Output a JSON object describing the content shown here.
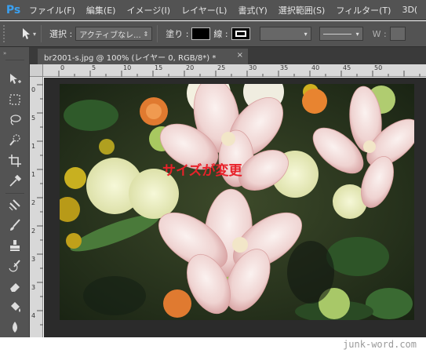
{
  "app": {
    "logo": "Ps"
  },
  "menu": {
    "items": [
      "ファイル(F)",
      "編集(E)",
      "イメージ(I)",
      "レイヤー(L)",
      "書式(Y)",
      "選択範囲(S)",
      "フィルター(T)",
      "3D("
    ]
  },
  "options": {
    "select_label": "選択 :",
    "select_value": "アクティブなレ...",
    "fill_label": "塗り :",
    "stroke_label": "線 :",
    "width_label": "W :"
  },
  "document": {
    "tab_title": "br2001-s.jpg @ 100% (レイヤー 0, RGB/8*) *",
    "close_glyph": "×"
  },
  "ruler": {
    "top_labels": [
      "0",
      "5",
      "10",
      "15",
      "20",
      "25",
      "30",
      "35",
      "40",
      "45",
      "50"
    ],
    "left_labels": [
      "0",
      "5",
      "1",
      "1",
      "2",
      "2",
      "3",
      "3",
      "4"
    ]
  },
  "canvas": {
    "overlay_text": "サイズが変更"
  },
  "footer": {
    "watermark": "junk-word.com"
  },
  "colors": {
    "chrome": "#535353",
    "pasteboard": "#2b2b2b",
    "overlay_text": "#e8222a"
  },
  "toolbar": {
    "tools": [
      "move-tool-icon",
      "marquee-icon",
      "lasso-icon",
      "quick-select-icon",
      "crop-icon",
      "eyedropper-icon",
      "healing-icon",
      "brush-icon",
      "stamp-icon",
      "history-brush-icon",
      "eraser-icon",
      "bucket-icon",
      "blur-icon"
    ]
  }
}
